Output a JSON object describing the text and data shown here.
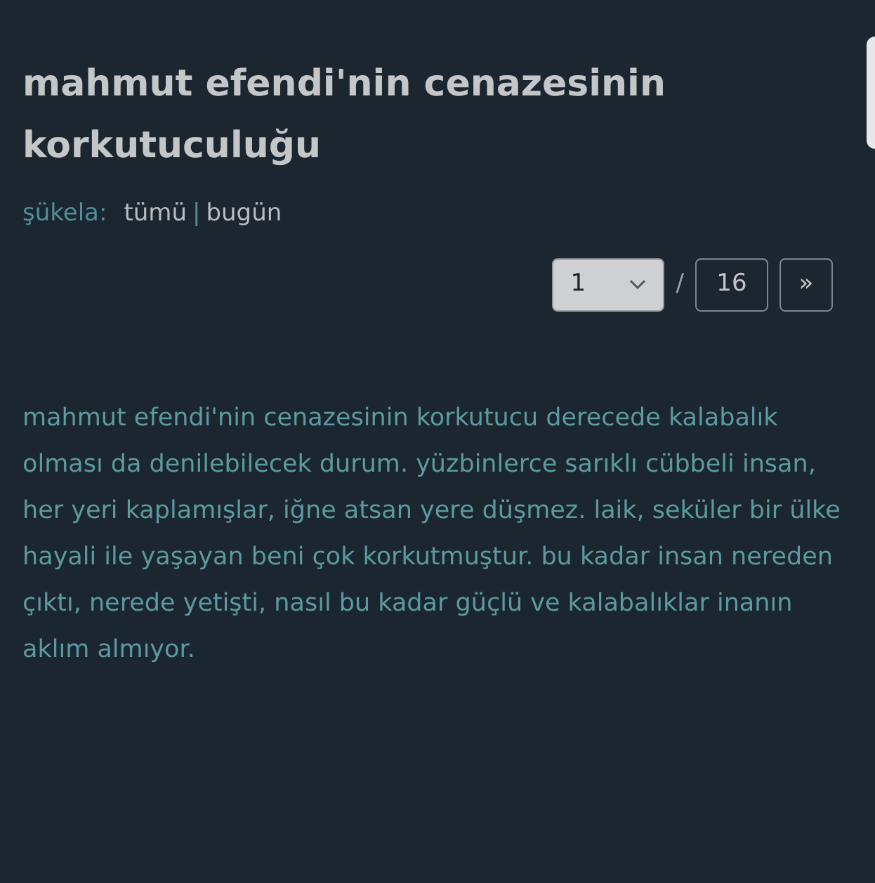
{
  "title": "mahmut efendi'nin cenazesinin korkutuculuğu",
  "filter": {
    "label": "şükela:",
    "options": [
      {
        "label": "tümü"
      },
      {
        "label": "bugün"
      }
    ],
    "separator": "|"
  },
  "pager": {
    "page": "1",
    "separator": "/",
    "total": "16",
    "next": "»"
  },
  "entry": {
    "text": "mahmut efendi'nin cenazesinin korkutucu derecede kalabalık olması da denilebilecek durum. yüzbinlerce sarıklı cübbeli insan, her yeri kaplamışlar, iğne atsan yere düşmez. laik, seküler bir ülke hayali ile yaşayan beni çok korkutmuştur. bu kadar insan nereden çıktı, nerede yetişti, nasıl bu kadar güçlü ve kalabalıklar inanın aklım almıyor."
  }
}
